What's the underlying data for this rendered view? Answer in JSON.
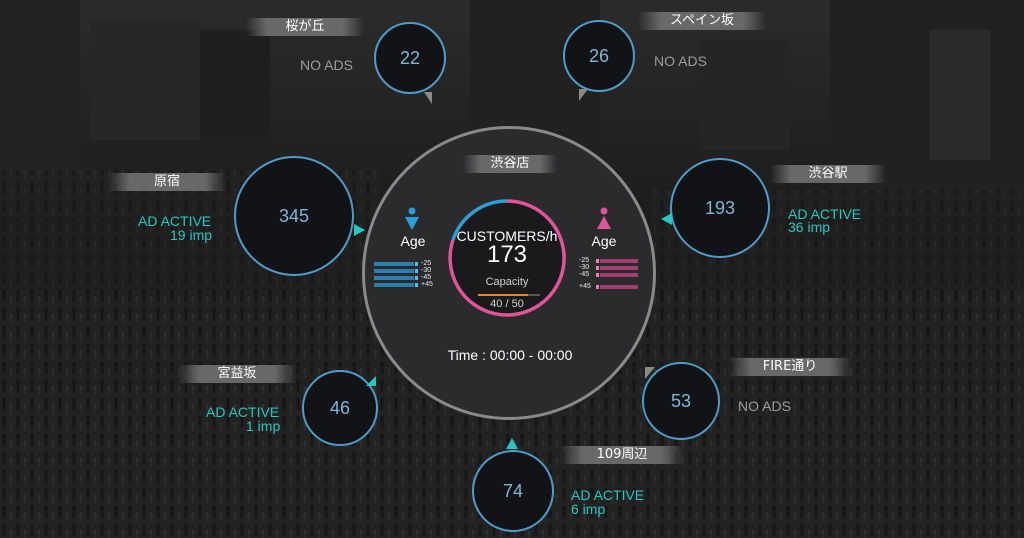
{
  "hub": {
    "store_name": "渋谷店",
    "customers_label": "CUSTOMERS/h",
    "customers_value": "173",
    "capacity_label": "Capacity",
    "capacity_value": "40 / 50",
    "capacity_fraction": 0.8,
    "time_text": "Time : 00:00 - 00:00",
    "male_age_label": "Age",
    "female_age_label": "Age",
    "age_groups": [
      "-25",
      "-30",
      "-45",
      "+45"
    ]
  },
  "locations": {
    "sakuragaoka": {
      "name": "桜が丘",
      "count": "22",
      "status": "NO ADS"
    },
    "spain_zaka": {
      "name": "スペイン坂",
      "count": "26",
      "status": "NO ADS"
    },
    "harajuku": {
      "name": "原宿",
      "count": "345",
      "status": "AD ACTIVE",
      "impressions": "19 imp"
    },
    "shibuya_station": {
      "name": "渋谷駅",
      "count": "193",
      "status": "AD ACTIVE",
      "impressions": "36 imp"
    },
    "miyamasuzaka": {
      "name": "宮益坂",
      "count": "46",
      "status": "AD ACTIVE",
      "impressions": "1 imp"
    },
    "fire_dori": {
      "name": "FIRE通り",
      "count": "53",
      "status": "NO ADS"
    },
    "around_109": {
      "name": "109周辺",
      "count": "74",
      "status": "AD ACTIVE",
      "impressions": "6 imp"
    }
  },
  "colors": {
    "male": "#2a9fd6",
    "female": "#e0559a",
    "ad_active": "#28c7c0",
    "no_ads": "#9c9c9c",
    "bubble_border": "#4f9cc8",
    "capacity_bar": "#e88a2a"
  }
}
